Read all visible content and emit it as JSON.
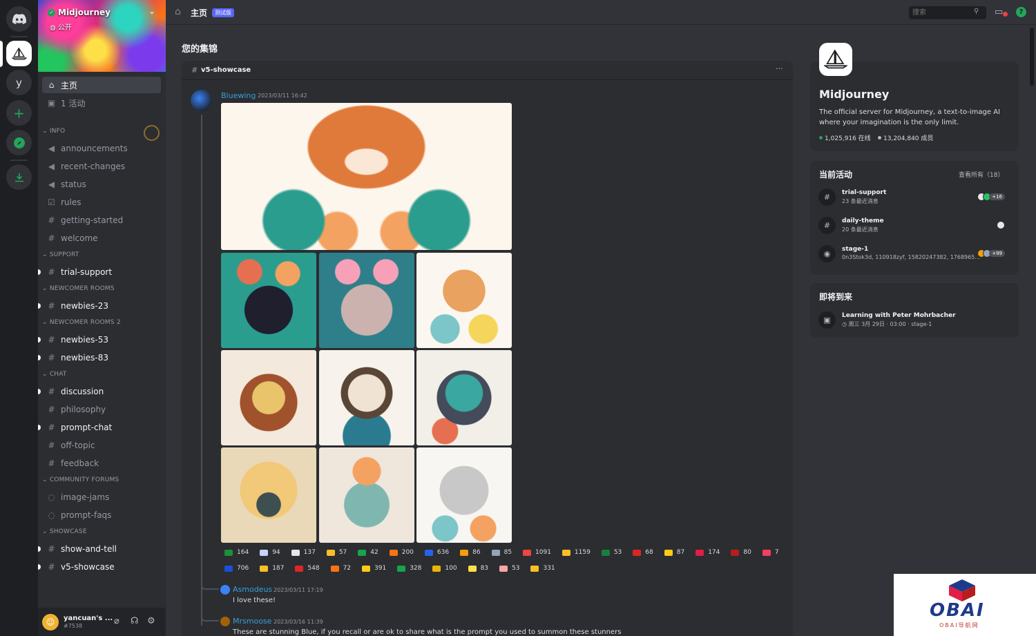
{
  "server": {
    "name": "Midjourney",
    "visibility": "公开"
  },
  "nav": {
    "home": "主页",
    "events": "1 活动"
  },
  "categories": [
    {
      "label": "INFO",
      "channels": [
        {
          "name": "announcements",
          "icon": "megaphone-icon",
          "unread": false
        },
        {
          "name": "recent-changes",
          "icon": "megaphone-icon",
          "unread": false
        },
        {
          "name": "status",
          "icon": "megaphone-icon",
          "unread": false
        },
        {
          "name": "rules",
          "icon": "checkbox-icon",
          "unread": false
        },
        {
          "name": "getting-started",
          "icon": "hash-icon",
          "unread": false
        },
        {
          "name": "welcome",
          "icon": "hash-icon",
          "unread": false
        }
      ]
    },
    {
      "label": "SUPPORT",
      "channels": [
        {
          "name": "trial-support",
          "icon": "hash-icon",
          "unread": true
        }
      ]
    },
    {
      "label": "NEWCOMER ROOMS",
      "channels": [
        {
          "name": "newbies-23",
          "icon": "thread-hash-icon",
          "unread": true
        }
      ]
    },
    {
      "label": "NEWCOMER ROOMS 2",
      "channels": [
        {
          "name": "newbies-53",
          "icon": "thread-hash-icon",
          "unread": true
        },
        {
          "name": "newbies-83",
          "icon": "thread-hash-icon",
          "unread": true
        }
      ]
    },
    {
      "label": "CHAT",
      "channels": [
        {
          "name": "discussion",
          "icon": "hash-icon",
          "unread": true
        },
        {
          "name": "philosophy",
          "icon": "hash-icon",
          "unread": false
        },
        {
          "name": "prompt-chat",
          "icon": "hash-icon",
          "unread": true
        },
        {
          "name": "off-topic",
          "icon": "hash-icon",
          "unread": false
        },
        {
          "name": "feedback",
          "icon": "hash-icon",
          "unread": false
        }
      ]
    },
    {
      "label": "COMMUNITY FORUMS",
      "channels": [
        {
          "name": "image-jams",
          "icon": "forum-icon",
          "unread": false
        },
        {
          "name": "prompt-faqs",
          "icon": "forum-icon",
          "unread": false
        }
      ]
    },
    {
      "label": "SHOWCASE",
      "channels": [
        {
          "name": "show-and-tell",
          "icon": "hash-icon",
          "unread": true
        },
        {
          "name": "v5-showcase",
          "icon": "hash-icon",
          "unread": true
        }
      ]
    }
  ],
  "user": {
    "name": "yancuan's ...",
    "tag": "#7538"
  },
  "topbar": {
    "title": "主页",
    "beta_badge": "测试版",
    "search_placeholder": "搜索"
  },
  "main": {
    "section_title": "您的集锦",
    "post": {
      "channel": "v5-showcase",
      "author": "Bluewing",
      "time": "2023/03/11 16:42",
      "reactions_row1": [
        {
          "count": "164",
          "color": "#1f8f3a"
        },
        {
          "count": "94",
          "color": "#c7d2fe"
        },
        {
          "count": "137",
          "color": "#e5e7eb"
        },
        {
          "count": "57",
          "color": "#fbbf24"
        },
        {
          "count": "42",
          "color": "#16a34a"
        },
        {
          "count": "200",
          "color": "#f97316"
        },
        {
          "count": "636",
          "color": "#2563eb"
        },
        {
          "count": "86",
          "color": "#f59e0b"
        },
        {
          "count": "85",
          "color": "#94a3b8"
        },
        {
          "count": "1091",
          "color": "#ef4444"
        },
        {
          "count": "1159",
          "color": "#fbbf24"
        },
        {
          "count": "53",
          "color": "#15803d"
        },
        {
          "count": "68",
          "color": "#dc2626"
        },
        {
          "count": "87",
          "color": "#facc15"
        },
        {
          "count": "174",
          "color": "#e11d48"
        },
        {
          "count": "80",
          "color": "#b91c1c"
        },
        {
          "count": "7",
          "color": "#f43f5e"
        }
      ],
      "reactions_row2": [
        {
          "count": "706",
          "color": "#1d4ed8"
        },
        {
          "count": "187",
          "color": "#fbbf24"
        },
        {
          "count": "548",
          "color": "#dc2626"
        },
        {
          "count": "72",
          "color": "#f97316"
        },
        {
          "count": "391",
          "color": "#facc15"
        },
        {
          "count": "328",
          "color": "#16a34a"
        },
        {
          "count": "100",
          "color": "#eab308"
        },
        {
          "count": "83",
          "color": "#fde047"
        },
        {
          "count": "53",
          "color": "#fca5a5"
        },
        {
          "count": "331",
          "color": "#fbbf24"
        }
      ],
      "replies": [
        {
          "author": "Asmodeus",
          "time": "2023/03/11 17:19",
          "text": "I love these!",
          "color": "#3b9fd8"
        },
        {
          "author": "Mrsmoose",
          "time": "2023/03/16 11:39",
          "text": "These are stunning Blue, if you recall or are ok to share what is the prompt you used to summon these stunners",
          "color": "#3b9fd8"
        }
      ]
    }
  },
  "right": {
    "server_name": "Midjourney",
    "description": "The official server for Midjourney, a text-to-image AI where your imagination is the only limit.",
    "online": "1,025,916 在线",
    "members": "13,204,840 成员",
    "activity_title": "当前活动",
    "view_all": "查看所有（18）",
    "activities": [
      {
        "name": "trial-support",
        "sub": "23 条最近消息",
        "extra": "+16",
        "icon": "hash-icon"
      },
      {
        "name": "daily-theme",
        "sub": "20 条最近消息",
        "extra": "",
        "icon": "hash-icon"
      },
      {
        "name": "stage-1",
        "sub": "0n3Stok3d, 110918zyf, 15820247382, 17689658406...",
        "extra": "+99",
        "icon": "stage-icon"
      }
    ],
    "upcoming_title": "即将到来",
    "event": {
      "name": "Learning with Peter Mohrbacher",
      "when": "周三 3月 29日 · 03:00 · stage-1"
    }
  },
  "watermark": {
    "text": "OBAI",
    "sub": "OBAI导航网"
  },
  "colors": {
    "accent": "#5865f2",
    "online": "#23a55a",
    "link": "#3b9fd8"
  }
}
